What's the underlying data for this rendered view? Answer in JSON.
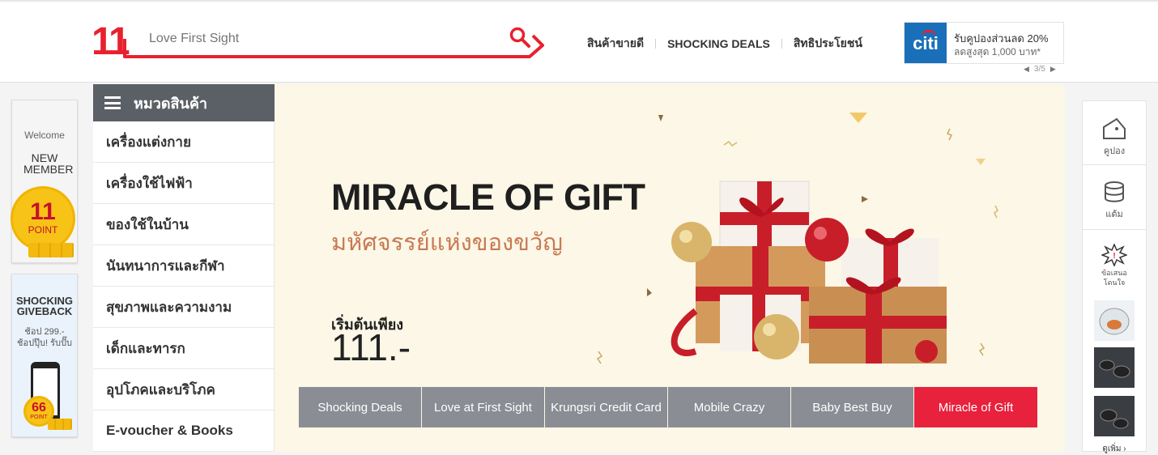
{
  "header": {
    "logo": "11",
    "search_placeholder": "Love First Sight",
    "nav": [
      "สินค้าขายดี",
      "SHOCKING DEALS",
      "สิทธิประโยชน์"
    ],
    "promo": {
      "brand": "citi",
      "line1": "รับคูปองส่วนลด 20%",
      "line2": "ลดสูงสุด 1,000 บาท*",
      "pager": "3/5"
    }
  },
  "left_cards": {
    "welcome": "Welcome",
    "new_member": "NEW MEMBER",
    "point_number": "11",
    "point_label": "POINT",
    "giveback_title": "SHOCKING GIVEBACK",
    "giveback_sub1": "ช้อป 299.-",
    "giveback_sub2": "ช้อปปุ๊บ! รับปั๊บ",
    "giveback_number": "66",
    "giveback_label": "POINT"
  },
  "categories": {
    "title": "หมวดสินค้า",
    "items": [
      "เครื่องแต่งกาย",
      "เครื่องใช้ไฟฟ้า",
      "ของใช้ในบ้าน",
      "นันทนาการและกีฬา",
      "สุขภาพและความงาม",
      "เด็กและทารก",
      "อุปโภคและบริโภค",
      "E-voucher & Books"
    ]
  },
  "banner": {
    "title": "MIRACLE OF GIFT",
    "subtitle": "มหัศจรรย์แห่งของขวัญ",
    "start_label": "เริ่มต้นเพียง",
    "price": "111.-",
    "tabs": [
      "Shocking Deals",
      "Love at First Sight",
      "Krungsri Credit Card",
      "Mobile Crazy",
      "Baby Best Buy",
      "Miracle of Gift"
    ],
    "active_tab": 5,
    "accent": "#e8213c"
  },
  "right_sidebar": {
    "coupon": "คูปอง",
    "points": "แต้ม",
    "offer1": "ข้อเสนอ",
    "offer2": "โดนใจ",
    "more": "ดูเพิ่ม"
  },
  "colors": {
    "brand_red": "#e8212e",
    "category_header": "#5b5f66",
    "tab_gray": "#8a8d93",
    "banner_bg": "#fcf7e6"
  }
}
